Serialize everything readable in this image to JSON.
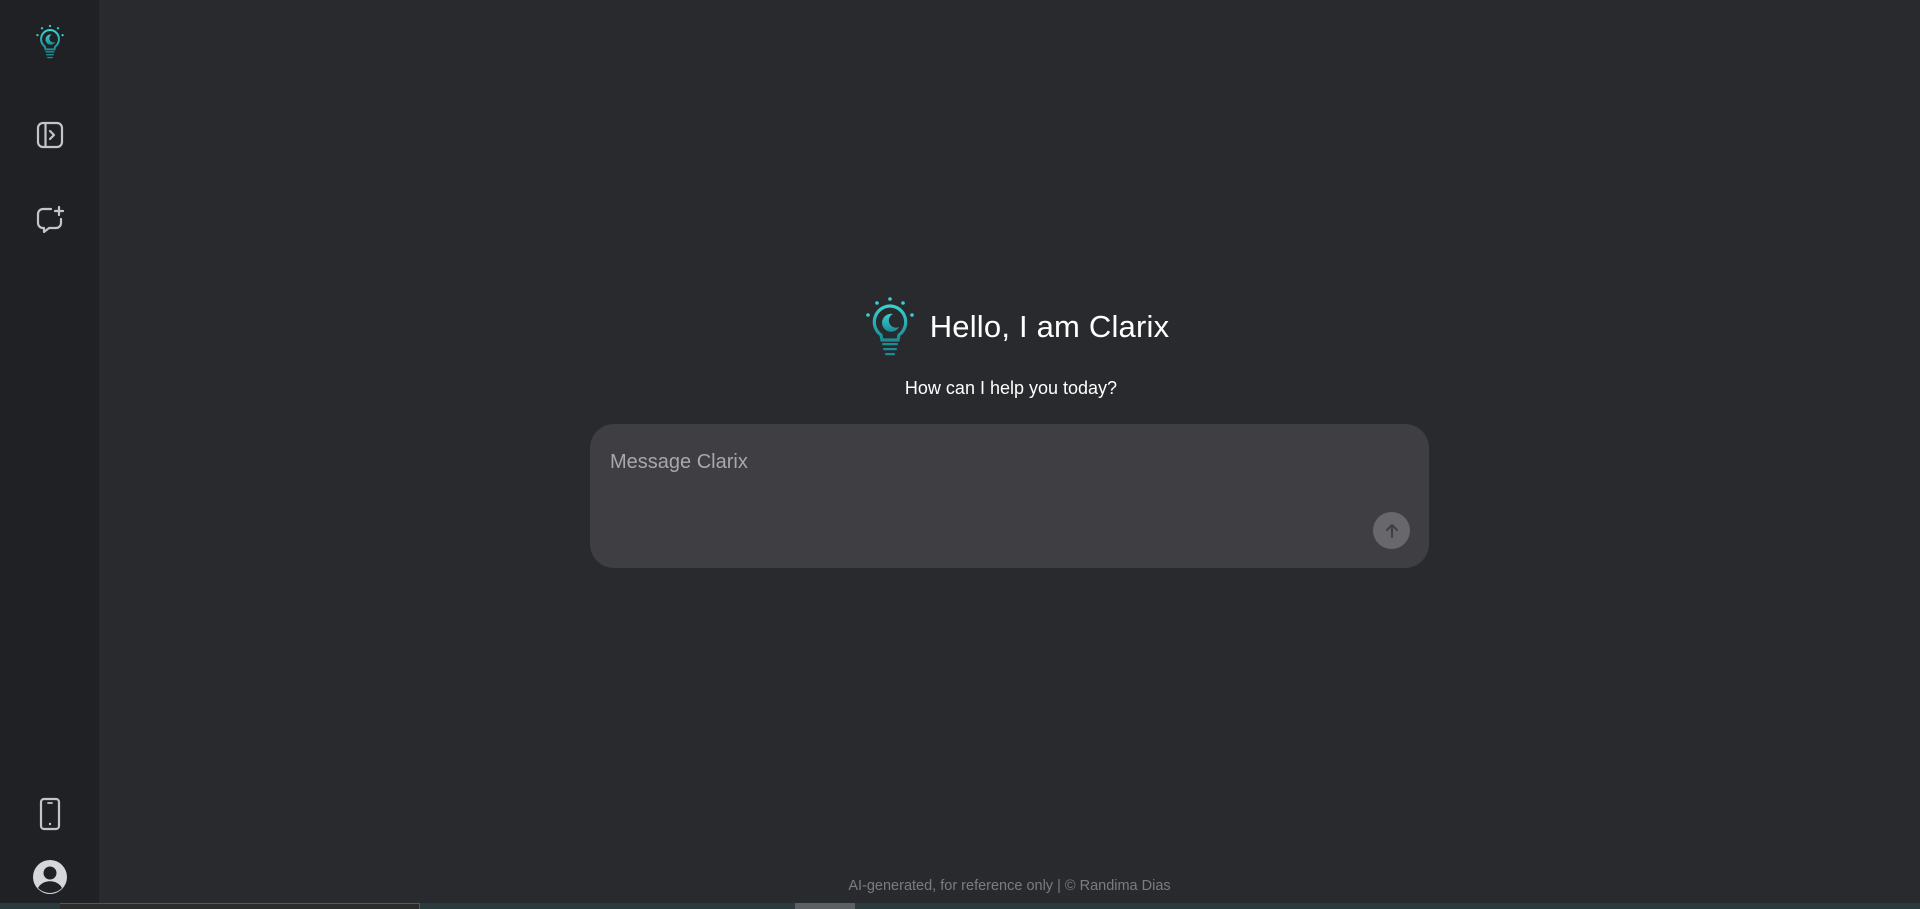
{
  "sidebar": {
    "logo_icon": "lightbulb-logo-icon",
    "toggle_icon": "sidebar-toggle-icon",
    "newchat_icon": "new-chat-icon",
    "mobile_icon": "mobile-phone-icon",
    "avatar_icon": "user-avatar-icon"
  },
  "hero": {
    "title": "Hello, I am Clarix",
    "subtitle": "How can I help you today?"
  },
  "composer": {
    "placeholder": "Message Clarix",
    "value": "",
    "send_icon": "arrow-up-icon"
  },
  "footer": {
    "text": "AI-generated, for reference only | © Randima Dias"
  },
  "colors": {
    "background": "#292a2e",
    "sidebar": "#202124",
    "accent_teal": "#1fb5b8",
    "composer": "#3f3f43",
    "send_button": "#67676c"
  }
}
